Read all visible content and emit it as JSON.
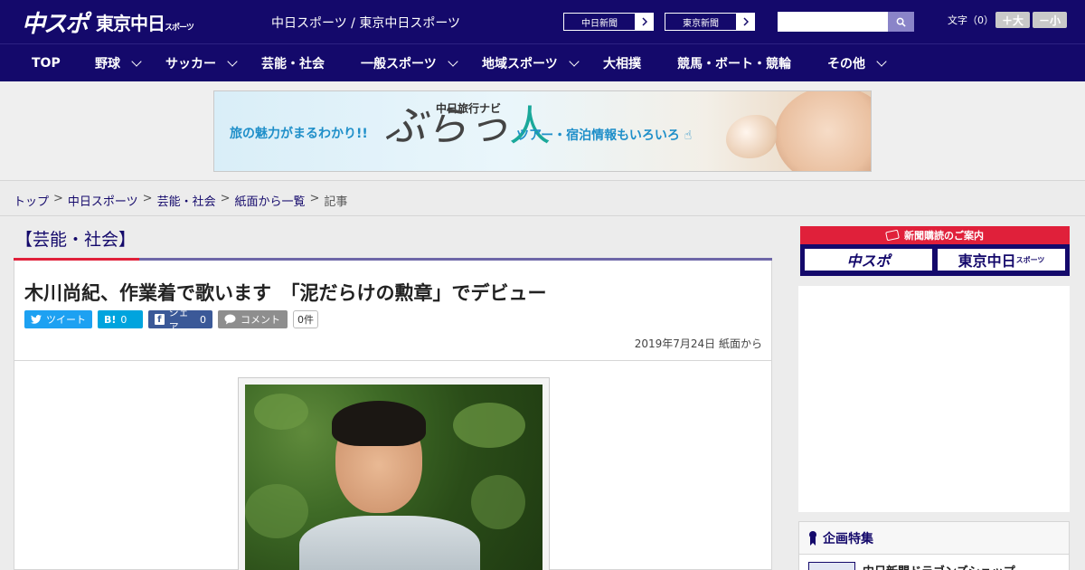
{
  "header": {
    "logo_main": "中スポ",
    "logo_sub": "東京中日",
    "logo_sub_small": "スポーツ",
    "site_title": "中日スポーツ / 東京中日スポーツ",
    "paper_links": [
      {
        "label": "中日新聞"
      },
      {
        "label": "東京新聞"
      }
    ],
    "search": {
      "placeholder": "",
      "value": ""
    },
    "font_size": {
      "label": "文字（0）",
      "increase": "＋大",
      "decrease": "－小"
    }
  },
  "nav": {
    "items": [
      {
        "label": "TOP",
        "has_menu": false
      },
      {
        "label": "野球",
        "has_menu": true
      },
      {
        "label": "サッカー",
        "has_menu": true
      },
      {
        "label": "芸能・社会",
        "has_menu": false
      },
      {
        "label": "一般スポーツ",
        "has_menu": true
      },
      {
        "label": "地域スポーツ",
        "has_menu": true
      },
      {
        "label": "大相撲",
        "has_menu": false
      },
      {
        "label": "競馬・ボート・競輪",
        "has_menu": false
      },
      {
        "label": "その他",
        "has_menu": true
      }
    ]
  },
  "banner": {
    "brand_small": "中日旅行ナビ",
    "lead": "旅の魅力がまるわかり!!",
    "logo_kana": "ぶらっ",
    "logo_kanji": "人",
    "tail": "ツアー・宿泊情報もいろいろ"
  },
  "breadcrumb": {
    "items": [
      "トップ",
      "中日スポーツ",
      "芸能・社会",
      "紙面から一覧"
    ],
    "current": "記事",
    "separator": ">"
  },
  "article": {
    "category": "【芸能・社会】",
    "title": "木川尚紀、作業着で歌います　「泥だらけの勲章」でデビュー",
    "share": {
      "tweet": "ツイート",
      "hatena_icon": "B!",
      "hatena_count": "0",
      "facebook": "シェア",
      "facebook_count": "0",
      "comment": "コメント",
      "comment_count": "0件"
    },
    "date": "2019年7月24日 紙面から"
  },
  "sidebar": {
    "subscribe_heading": "新聞購読のご案内",
    "subscribe_buttons": [
      "中スポ",
      "東京中日"
    ],
    "subscribe_small": "スポーツ",
    "feature_heading": "企画特集",
    "feature_item": "中日新聞ドラゴンズショップ"
  },
  "colors": {
    "brand_navy": "#14096b",
    "accent_red": "#e0203a",
    "twitter": "#1da1f2",
    "hatena": "#00a4de",
    "facebook": "#3b5998"
  },
  "icons": [
    "search-icon",
    "chevron-right-icon",
    "chevron-down-icon",
    "twitter-icon",
    "facebook-icon",
    "comment-icon",
    "ticket-icon",
    "ribbon-icon"
  ]
}
